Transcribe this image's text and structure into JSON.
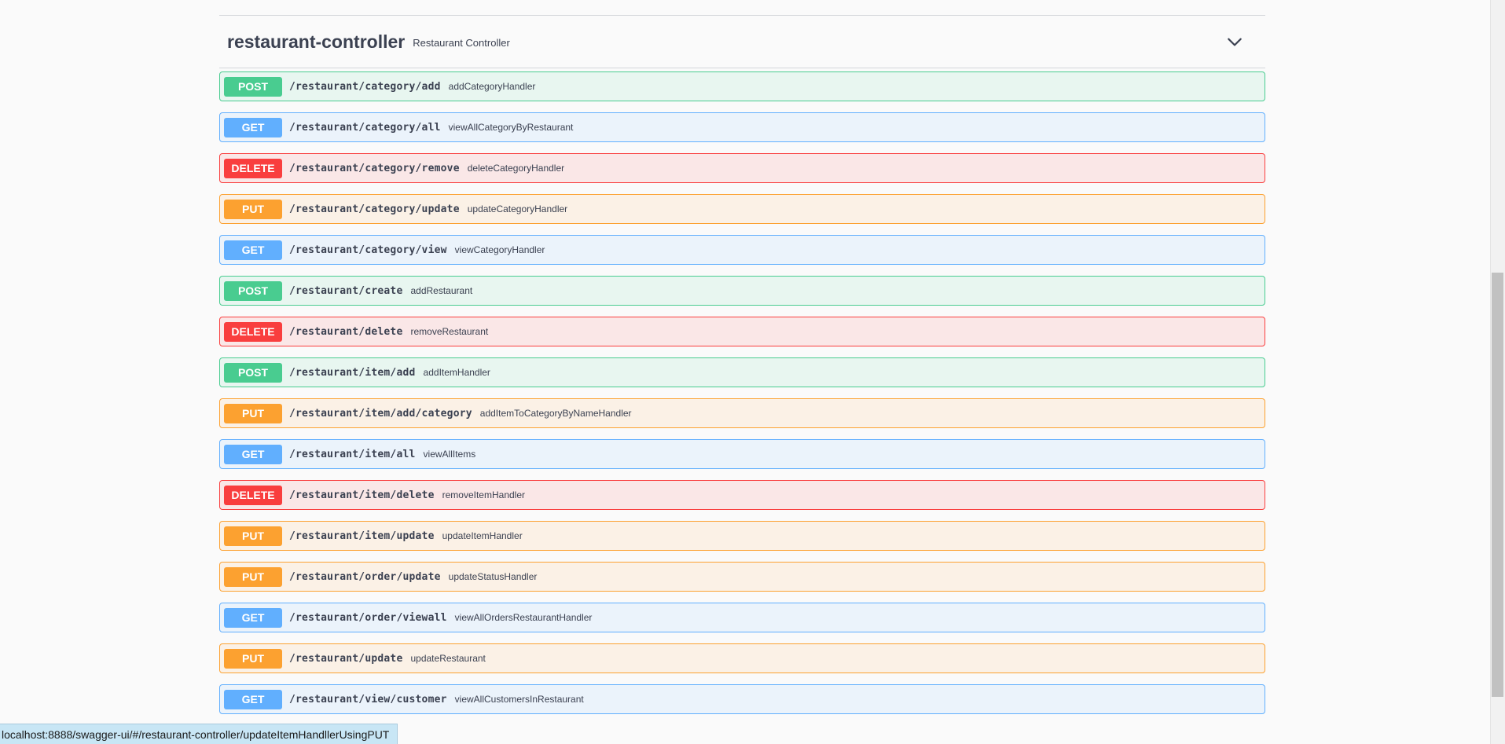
{
  "tag": {
    "name": "restaurant-controller",
    "description": "Restaurant Controller",
    "expanded": true
  },
  "operations": [
    {
      "method": "POST",
      "path": "/restaurant/category/add",
      "operation_id": "addCategoryHandler"
    },
    {
      "method": "GET",
      "path": "/restaurant/category/all",
      "operation_id": "viewAllCategoryByRestaurant"
    },
    {
      "method": "DELETE",
      "path": "/restaurant/category/remove",
      "operation_id": "deleteCategoryHandler"
    },
    {
      "method": "PUT",
      "path": "/restaurant/category/update",
      "operation_id": "updateCategoryHandler"
    },
    {
      "method": "GET",
      "path": "/restaurant/category/view",
      "operation_id": "viewCategoryHandler"
    },
    {
      "method": "POST",
      "path": "/restaurant/create",
      "operation_id": "addRestaurant"
    },
    {
      "method": "DELETE",
      "path": "/restaurant/delete",
      "operation_id": "removeRestaurant"
    },
    {
      "method": "POST",
      "path": "/restaurant/item/add",
      "operation_id": "addItemHandler"
    },
    {
      "method": "PUT",
      "path": "/restaurant/item/add/category",
      "operation_id": "addItemToCategoryByNameHandler"
    },
    {
      "method": "GET",
      "path": "/restaurant/item/all",
      "operation_id": "viewAllItems"
    },
    {
      "method": "DELETE",
      "path": "/restaurant/item/delete",
      "operation_id": "removeItemHandler"
    },
    {
      "method": "PUT",
      "path": "/restaurant/item/update",
      "operation_id": "updateItemHandler"
    },
    {
      "method": "PUT",
      "path": "/restaurant/order/update",
      "operation_id": "updateStatusHandler"
    },
    {
      "method": "GET",
      "path": "/restaurant/order/viewall",
      "operation_id": "viewAllOrdersRestaurantHandler"
    },
    {
      "method": "PUT",
      "path": "/restaurant/update",
      "operation_id": "updateRestaurant"
    },
    {
      "method": "GET",
      "path": "/restaurant/view/customer",
      "operation_id": "viewAllCustomersInRestaurant"
    }
  ],
  "colors": {
    "post": "#49cc90",
    "get": "#61affe",
    "delete": "#f93e3e",
    "put": "#fca130"
  },
  "status_bar": {
    "url": "localhost:8888/swagger-ui/#/restaurant-controller/updateItemHandllerUsingPUT"
  },
  "icons": {
    "toggle": "chevron-down-icon"
  }
}
